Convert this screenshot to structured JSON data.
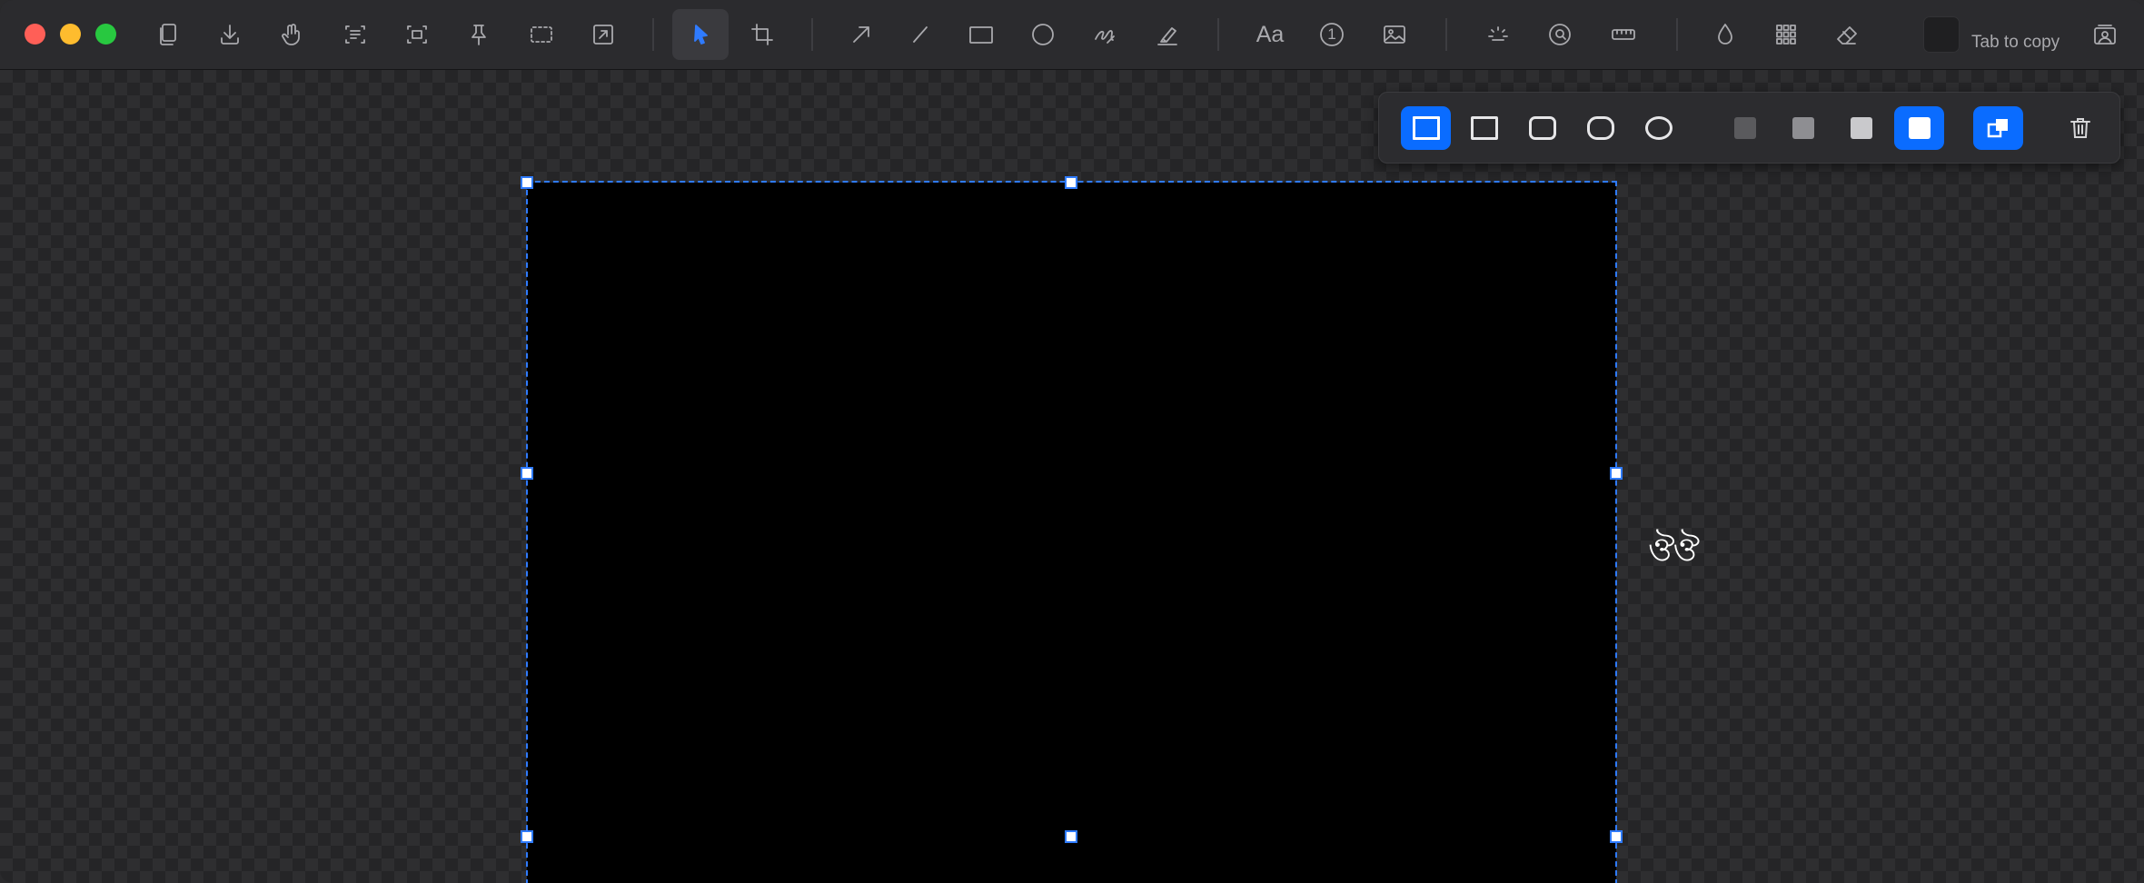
{
  "window": {
    "controls": [
      "close",
      "minimize",
      "zoom"
    ]
  },
  "toolbar": {
    "tools": [
      {
        "name": "copy-file-icon"
      },
      {
        "name": "download-icon"
      },
      {
        "name": "hand-drag-icon"
      },
      {
        "name": "text-recognition-icon"
      },
      {
        "name": "ocr-region-icon"
      },
      {
        "name": "pin-icon"
      },
      {
        "name": "capture-area-icon"
      },
      {
        "name": "resize-icon"
      },
      {
        "name": "select-arrow-icon",
        "active": true
      },
      {
        "name": "crop-icon"
      },
      {
        "name": "arrow-tool-icon"
      },
      {
        "name": "line-tool-icon"
      },
      {
        "name": "rectangle-tool-icon"
      },
      {
        "name": "ellipse-tool-icon"
      },
      {
        "name": "pen-tool-icon"
      },
      {
        "name": "highlighter-tool-icon"
      },
      {
        "name": "text-tool",
        "label": "Aa"
      },
      {
        "name": "counter-tool",
        "label": "1"
      },
      {
        "name": "image-tool-icon"
      },
      {
        "name": "spotlight-icon"
      },
      {
        "name": "magnifier-icon"
      },
      {
        "name": "ruler-icon"
      },
      {
        "name": "blur-drop-icon"
      },
      {
        "name": "pixelate-grid-icon"
      },
      {
        "name": "eraser-icon"
      },
      {
        "name": "background-image-icon"
      }
    ],
    "tab_copy_label": "Tab to copy",
    "current_color": "#1f1f21"
  },
  "canvas": {
    "image_glyph": "ঔঔ",
    "selection_color": "#2f7bff"
  },
  "context_bar": {
    "corner_styles": [
      "square-selected",
      "square",
      "rounded",
      "pill",
      "circle"
    ],
    "fill_options": [
      "dark",
      "medium",
      "light",
      "white-selected"
    ],
    "combine_option": "overlap-selected",
    "delete": "trash-icon"
  }
}
